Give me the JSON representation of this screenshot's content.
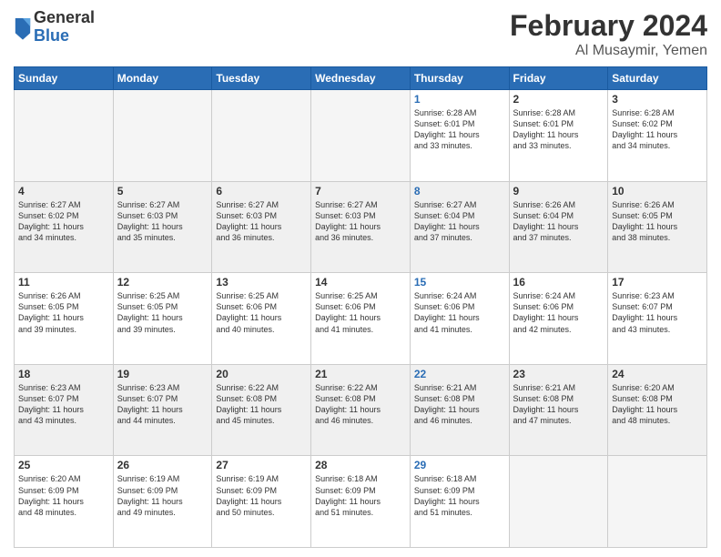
{
  "header": {
    "logo": {
      "general": "General",
      "blue": "Blue"
    },
    "month": "February 2024",
    "location": "Al Musaymir, Yemen"
  },
  "weekdays": [
    "Sunday",
    "Monday",
    "Tuesday",
    "Wednesday",
    "Thursday",
    "Friday",
    "Saturday"
  ],
  "weeks": [
    [
      {
        "day": "",
        "empty": true
      },
      {
        "day": "",
        "empty": true
      },
      {
        "day": "",
        "empty": true
      },
      {
        "day": "",
        "empty": true
      },
      {
        "day": "1",
        "sunrise": "6:28 AM",
        "sunset": "6:01 PM",
        "daylight": "11 hours and 33 minutes.",
        "thursday": true
      },
      {
        "day": "2",
        "sunrise": "6:28 AM",
        "sunset": "6:01 PM",
        "daylight": "11 hours and 33 minutes."
      },
      {
        "day": "3",
        "sunrise": "6:28 AM",
        "sunset": "6:02 PM",
        "daylight": "11 hours and 34 minutes."
      }
    ],
    [
      {
        "day": "4",
        "sunrise": "6:27 AM",
        "sunset": "6:02 PM",
        "daylight": "11 hours and 34 minutes."
      },
      {
        "day": "5",
        "sunrise": "6:27 AM",
        "sunset": "6:03 PM",
        "daylight": "11 hours and 35 minutes."
      },
      {
        "day": "6",
        "sunrise": "6:27 AM",
        "sunset": "6:03 PM",
        "daylight": "11 hours and 36 minutes."
      },
      {
        "day": "7",
        "sunrise": "6:27 AM",
        "sunset": "6:03 PM",
        "daylight": "11 hours and 36 minutes."
      },
      {
        "day": "8",
        "sunrise": "6:27 AM",
        "sunset": "6:04 PM",
        "daylight": "11 hours and 37 minutes.",
        "thursday": true
      },
      {
        "day": "9",
        "sunrise": "6:26 AM",
        "sunset": "6:04 PM",
        "daylight": "11 hours and 37 minutes."
      },
      {
        "day": "10",
        "sunrise": "6:26 AM",
        "sunset": "6:05 PM",
        "daylight": "11 hours and 38 minutes."
      }
    ],
    [
      {
        "day": "11",
        "sunrise": "6:26 AM",
        "sunset": "6:05 PM",
        "daylight": "11 hours and 39 minutes."
      },
      {
        "day": "12",
        "sunrise": "6:25 AM",
        "sunset": "6:05 PM",
        "daylight": "11 hours and 39 minutes."
      },
      {
        "day": "13",
        "sunrise": "6:25 AM",
        "sunset": "6:06 PM",
        "daylight": "11 hours and 40 minutes."
      },
      {
        "day": "14",
        "sunrise": "6:25 AM",
        "sunset": "6:06 PM",
        "daylight": "11 hours and 41 minutes."
      },
      {
        "day": "15",
        "sunrise": "6:24 AM",
        "sunset": "6:06 PM",
        "daylight": "11 hours and 41 minutes.",
        "thursday": true
      },
      {
        "day": "16",
        "sunrise": "6:24 AM",
        "sunset": "6:06 PM",
        "daylight": "11 hours and 42 minutes."
      },
      {
        "day": "17",
        "sunrise": "6:23 AM",
        "sunset": "6:07 PM",
        "daylight": "11 hours and 43 minutes."
      }
    ],
    [
      {
        "day": "18",
        "sunrise": "6:23 AM",
        "sunset": "6:07 PM",
        "daylight": "11 hours and 43 minutes."
      },
      {
        "day": "19",
        "sunrise": "6:23 AM",
        "sunset": "6:07 PM",
        "daylight": "11 hours and 44 minutes."
      },
      {
        "day": "20",
        "sunrise": "6:22 AM",
        "sunset": "6:08 PM",
        "daylight": "11 hours and 45 minutes."
      },
      {
        "day": "21",
        "sunrise": "6:22 AM",
        "sunset": "6:08 PM",
        "daylight": "11 hours and 46 minutes."
      },
      {
        "day": "22",
        "sunrise": "6:21 AM",
        "sunset": "6:08 PM",
        "daylight": "11 hours and 46 minutes.",
        "thursday": true
      },
      {
        "day": "23",
        "sunrise": "6:21 AM",
        "sunset": "6:08 PM",
        "daylight": "11 hours and 47 minutes."
      },
      {
        "day": "24",
        "sunrise": "6:20 AM",
        "sunset": "6:08 PM",
        "daylight": "11 hours and 48 minutes."
      }
    ],
    [
      {
        "day": "25",
        "sunrise": "6:20 AM",
        "sunset": "6:09 PM",
        "daylight": "11 hours and 48 minutes."
      },
      {
        "day": "26",
        "sunrise": "6:19 AM",
        "sunset": "6:09 PM",
        "daylight": "11 hours and 49 minutes."
      },
      {
        "day": "27",
        "sunrise": "6:19 AM",
        "sunset": "6:09 PM",
        "daylight": "11 hours and 50 minutes."
      },
      {
        "day": "28",
        "sunrise": "6:18 AM",
        "sunset": "6:09 PM",
        "daylight": "11 hours and 51 minutes."
      },
      {
        "day": "29",
        "sunrise": "6:18 AM",
        "sunset": "6:09 PM",
        "daylight": "11 hours and 51 minutes.",
        "thursday": true
      },
      {
        "day": "",
        "empty": true
      },
      {
        "day": "",
        "empty": true
      }
    ]
  ]
}
